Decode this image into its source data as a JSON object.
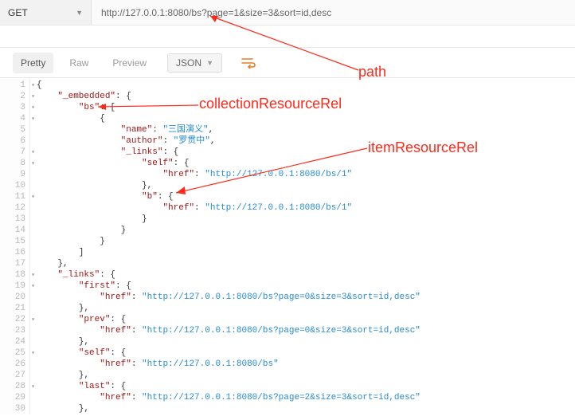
{
  "urlBar": {
    "method": "GET",
    "url": "http://127.0.0.1:8080/bs?page=1&size=3&sort=id,desc"
  },
  "tabs": {
    "pretty": "Pretty",
    "raw": "Raw",
    "preview": "Preview",
    "format": "JSON"
  },
  "annotations": {
    "path": "path",
    "collectionResourceRel": "collectionResourceRel",
    "itemResourceRel": "itemResourceRel"
  },
  "code": {
    "l1": "{",
    "l2": "    \"_embedded\": {",
    "l3": "        \"bs\": [",
    "l4": "            {",
    "l5": "                \"name\": \"三国演义\",",
    "l6": "                \"author\": \"罗贯中\",",
    "l7": "                \"_links\": {",
    "l8": "                    \"self\": {",
    "l9": "                        \"href\": \"http://127.0.0.1:8080/bs/1\"",
    "l10": "                    },",
    "l11": "                    \"b\": {",
    "l12": "                        \"href\": \"http://127.0.0.1:8080/bs/1\"",
    "l13": "                    }",
    "l14": "                }",
    "l15": "            }",
    "l16": "        ]",
    "l17": "    },",
    "l18": "    \"_links\": {",
    "l19": "        \"first\": {",
    "l20": "            \"href\": \"http://127.0.0.1:8080/bs?page=0&size=3&sort=id,desc\"",
    "l21": "        },",
    "l22": "        \"prev\": {",
    "l23": "            \"href\": \"http://127.0.0.1:8080/bs?page=0&size=3&sort=id,desc\"",
    "l24": "        },",
    "l25": "        \"self\": {",
    "l26": "            \"href\": \"http://127.0.0.1:8080/bs\"",
    "l27": "        },",
    "l28": "        \"last\": {",
    "l29": "            \"href\": \"http://127.0.0.1:8080/bs?page=2&size=3&sort=id,desc\"",
    "l30": "        },"
  }
}
